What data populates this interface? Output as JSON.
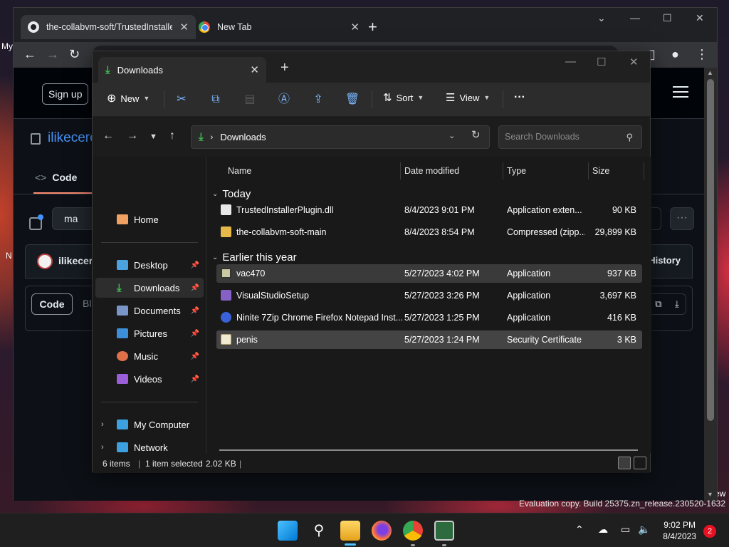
{
  "desktop": {
    "edge_texts": [
      "My",
      "N",
      "ew"
    ],
    "watermark": "Evaluation copy. Build 25375.zn_release.230520-1632"
  },
  "browser": {
    "tabs": [
      {
        "title": "the-collabvm-soft/TrustedInstalle",
        "icon": "github-icon",
        "active": true
      },
      {
        "title": "New Tab",
        "icon": "chrome-icon",
        "active": false
      }
    ],
    "github": {
      "sign_up": "Sign up",
      "repo_name": "ilikecere",
      "code_tab": "Code",
      "branch": "ma",
      "commit_user": "ilikecere",
      "history": "History",
      "file_code_btn": "Code",
      "blame": "Bl"
    }
  },
  "explorer": {
    "tab_title": "Downloads",
    "commands": {
      "new": "New",
      "sort": "Sort",
      "view": "View",
      "more": "···"
    },
    "address": {
      "path_label": "Downloads",
      "search_placeholder": "Search Downloads"
    },
    "nav": [
      {
        "label": "Home",
        "icon": "home-icon",
        "pinned": false
      },
      {
        "label": "Desktop",
        "icon": "desktop-icon",
        "pinned": true
      },
      {
        "label": "Downloads",
        "icon": "download-icon",
        "pinned": true,
        "selected": true
      },
      {
        "label": "Documents",
        "icon": "documents-icon",
        "pinned": true
      },
      {
        "label": "Pictures",
        "icon": "pictures-icon",
        "pinned": true
      },
      {
        "label": "Music",
        "icon": "music-icon",
        "pinned": true
      },
      {
        "label": "Videos",
        "icon": "videos-icon",
        "pinned": true
      },
      {
        "label": "My Computer",
        "icon": "computer-icon",
        "expandable": true
      },
      {
        "label": "Network",
        "icon": "network-icon",
        "expandable": true
      }
    ],
    "columns": [
      "Name",
      "Date modified",
      "Type",
      "Size"
    ],
    "groups": [
      {
        "label": "Today",
        "files": [
          {
            "name": "TrustedInstallerPlugin.dll",
            "date": "8/4/2023 9:01 PM",
            "type": "Application exten...",
            "size": "90 KB",
            "icon": "dll-file-icon"
          },
          {
            "name": "the-collabvm-soft-main",
            "date": "8/4/2023 8:54 PM",
            "type": "Compressed (zipp...",
            "size": "29,899 KB",
            "icon": "zip-folder-icon"
          }
        ]
      },
      {
        "label": "Earlier this year",
        "files": [
          {
            "name": "vac470",
            "date": "5/27/2023 4:02 PM",
            "type": "Application",
            "size": "937 KB",
            "icon": "app-icon"
          },
          {
            "name": "VisualStudioSetup",
            "date": "5/27/2023 3:26 PM",
            "type": "Application",
            "size": "3,697 KB",
            "icon": "visual-studio-icon"
          },
          {
            "name": "Ninite 7Zip Chrome Firefox Notepad Inst...",
            "date": "5/27/2023 1:25 PM",
            "type": "Application",
            "size": "416 KB",
            "icon": "ninite-icon"
          },
          {
            "name": "penis",
            "date": "5/27/2023 1:24 PM",
            "type": "Security Certificate",
            "size": "3 KB",
            "icon": "certificate-icon"
          }
        ]
      }
    ],
    "status": {
      "items": "6 items",
      "selection": "1 item selected",
      "size": "2.02 KB"
    }
  },
  "taskbar": {
    "time": "9:02 PM",
    "date": "8/4/2023",
    "notification_count": "2"
  }
}
